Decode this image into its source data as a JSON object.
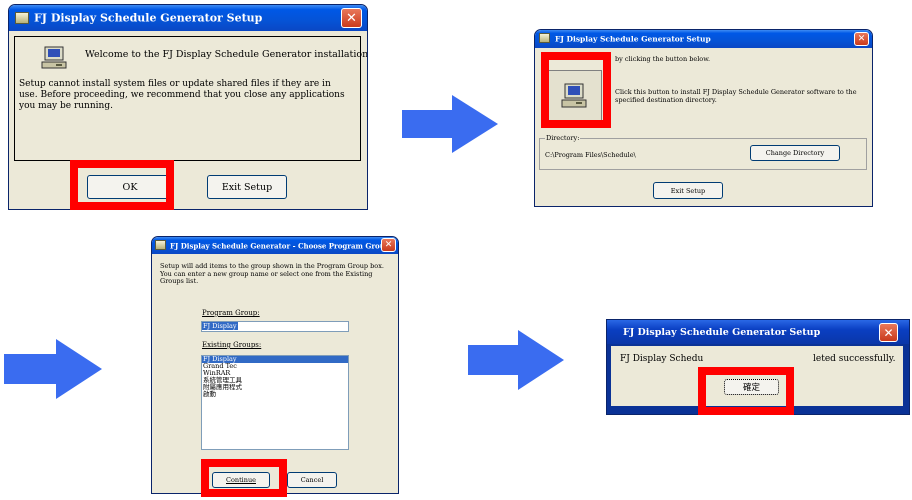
{
  "dialog_welcome": {
    "title": "FJ Display Schedule Generator Setup",
    "welcome_text": "Welcome to the FJ Display Schedule Generator installation program.",
    "warning_text": "Setup cannot install system files or update shared files if they are in use.  Before proceeding, we recommend that you close any applications you may be running.",
    "ok_label": "OK",
    "exit_label": "Exit Setup"
  },
  "dialog_directory": {
    "title": "FJ Display Schedule Generator Setup",
    "top_text": "by clicking the button below.",
    "install_text": "Click this button to install FJ Display Schedule Generator software to the specified destination directory.",
    "directory_label": "Directory:",
    "directory_value": "C:\\Program Files\\Schedule\\",
    "change_dir_label": "Change Directory",
    "exit_label": "Exit Setup"
  },
  "dialog_group": {
    "title": "FJ Display Schedule Generator - Choose Program Group",
    "intro_text": "Setup will add items to the group shown in the Program Group box. You can enter a new group name or select one from the Existing Groups list.",
    "program_group_label": "Program Group:",
    "program_group_value": "FJ Display",
    "existing_groups_label": "Existing Groups:",
    "existing_groups": [
      "FJ Display",
      "Grand Tec",
      "WinRAR",
      "系統管理工具",
      "附屬應用程式",
      "啟動"
    ],
    "continue_label": "Continue",
    "cancel_label": "Cancel"
  },
  "dialog_done": {
    "title": "FJ Display Schedule Generator Setup",
    "message": "FJ Display Schedule Generator Setup was completed successfully.",
    "message_visible_left": "FJ Display Schedu",
    "message_visible_right": "leted successfully.",
    "ok_label": "確定"
  },
  "colors": {
    "highlight": "#ff0000",
    "arrow": "#3a6cf0",
    "titlebar": "#0553d6",
    "dialog_bg": "#ece9d8"
  }
}
